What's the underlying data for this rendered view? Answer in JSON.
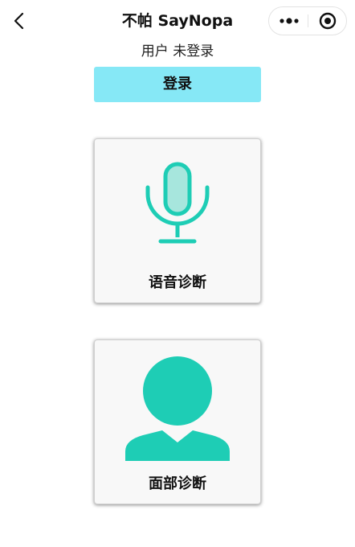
{
  "navbar": {
    "title": "不帕 SayNopa",
    "back_icon": "chevron-left-icon",
    "more_icon": "more-dots-icon",
    "close_icon": "target-circle-icon"
  },
  "user": {
    "label": "用户",
    "status": "未登录"
  },
  "login_button": {
    "label": "登录",
    "color": "#86e8f6"
  },
  "cards": [
    {
      "label": "语音诊断",
      "icon": "microphone-icon"
    },
    {
      "label": "面部诊断",
      "icon": "user-silhouette-icon"
    }
  ],
  "colors": {
    "accent": "#1ecdb5",
    "card_background": "#f8f8f8"
  }
}
